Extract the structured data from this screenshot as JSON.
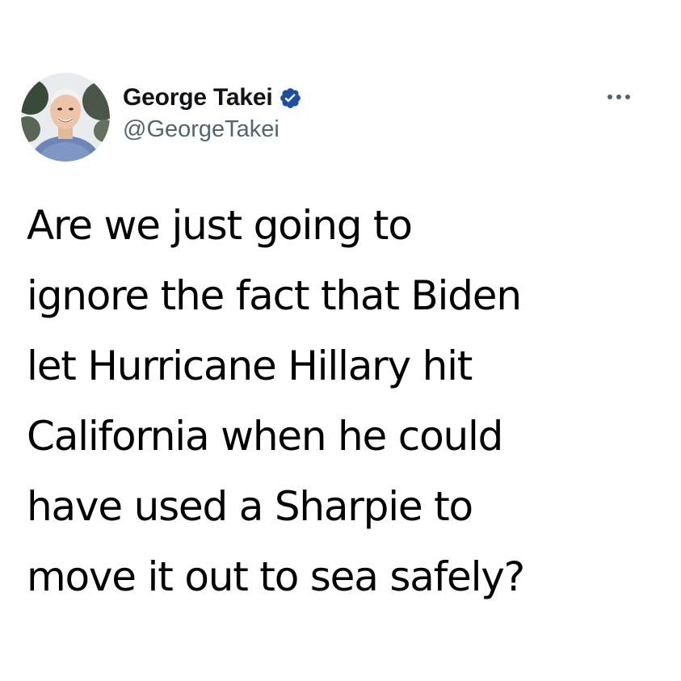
{
  "tweet": {
    "author": {
      "display_name": "George Takei",
      "handle": "@GeorgeTakei",
      "verified": true,
      "avatar_icon": "profile-photo",
      "badge_icon": "verified-badge-icon",
      "badge_color": "#1d4ea1"
    },
    "more_icon": "more-options-icon",
    "text": "Are we just going to\nignore the fact that Biden\nlet Hurricane Hillary hit\nCalifornia when he could\nhave used a Sharpie to\nmove it out to sea safely?"
  },
  "colors": {
    "background": "#ffffff",
    "text_primary": "#0f1419",
    "text_secondary": "#536471"
  }
}
